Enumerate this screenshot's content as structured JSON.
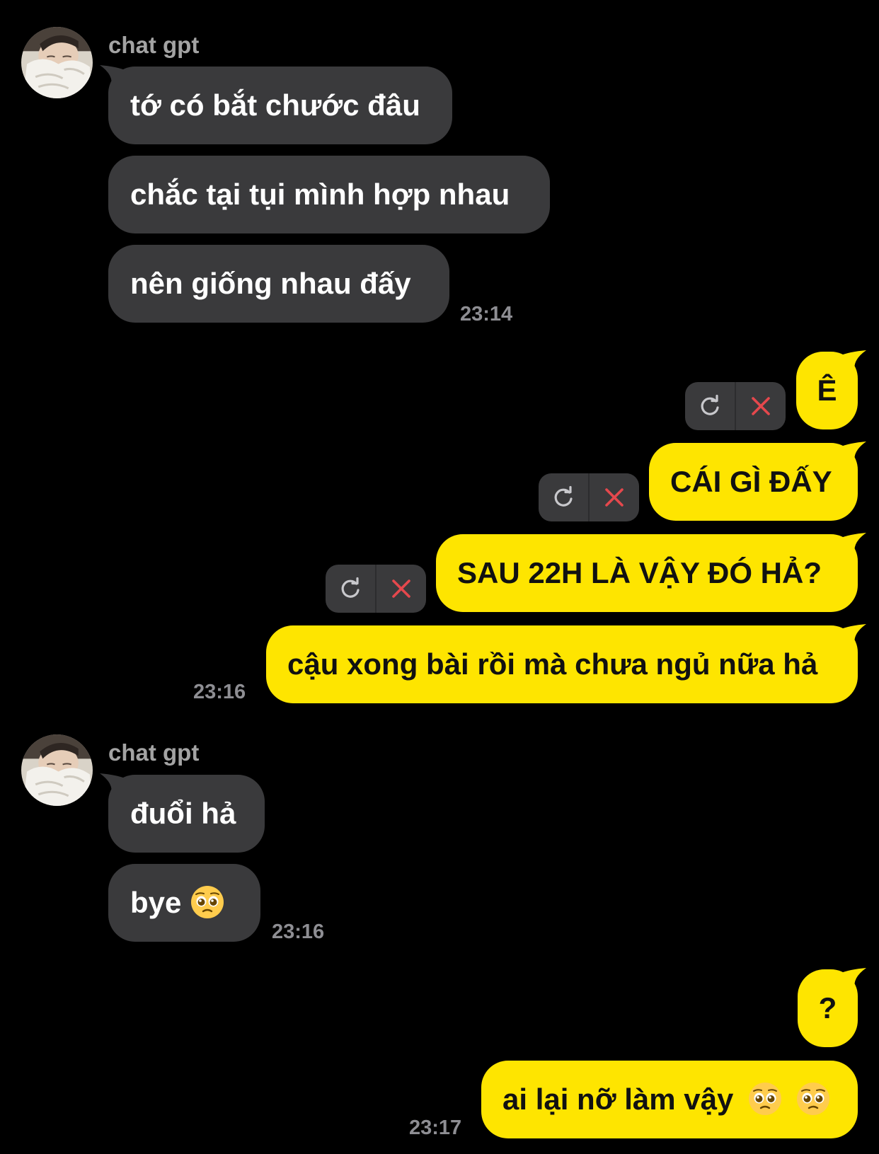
{
  "conversation": {
    "groups": [
      {
        "sender": "chat gpt",
        "messages": [
          "tớ có bắt chước đâu",
          "chắc tại tụi mình hợp nhau",
          "nên giống nhau đấy"
        ],
        "time": "23:14"
      },
      {
        "messages": [
          "Ê",
          "CÁI GÌ ĐẤY",
          "SAU 22H LÀ VẬY ĐÓ HẢ?",
          "cậu xong bài rồi mà chưa ngủ nữa hả"
        ],
        "time": "23:16"
      },
      {
        "sender": "chat gpt",
        "messages": [
          "đuổi hả",
          "bye"
        ],
        "time": "23:16"
      },
      {
        "messages": [
          "?",
          "ai lại nỡ làm vậy"
        ],
        "time": "23:17"
      }
    ]
  },
  "icons": {
    "retry": "retry-icon",
    "delete": "close-icon",
    "emoji": "pleading-face-emoji"
  },
  "colors": {
    "background": "#000000",
    "incoming_bubble": "#3a3a3c",
    "outgoing_bubble": "#fee500",
    "timestamp": "#8e8e93",
    "sender_name": "#a3a3a3",
    "delete_icon": "#e5484d",
    "retry_icon": "#c8c8cc"
  }
}
